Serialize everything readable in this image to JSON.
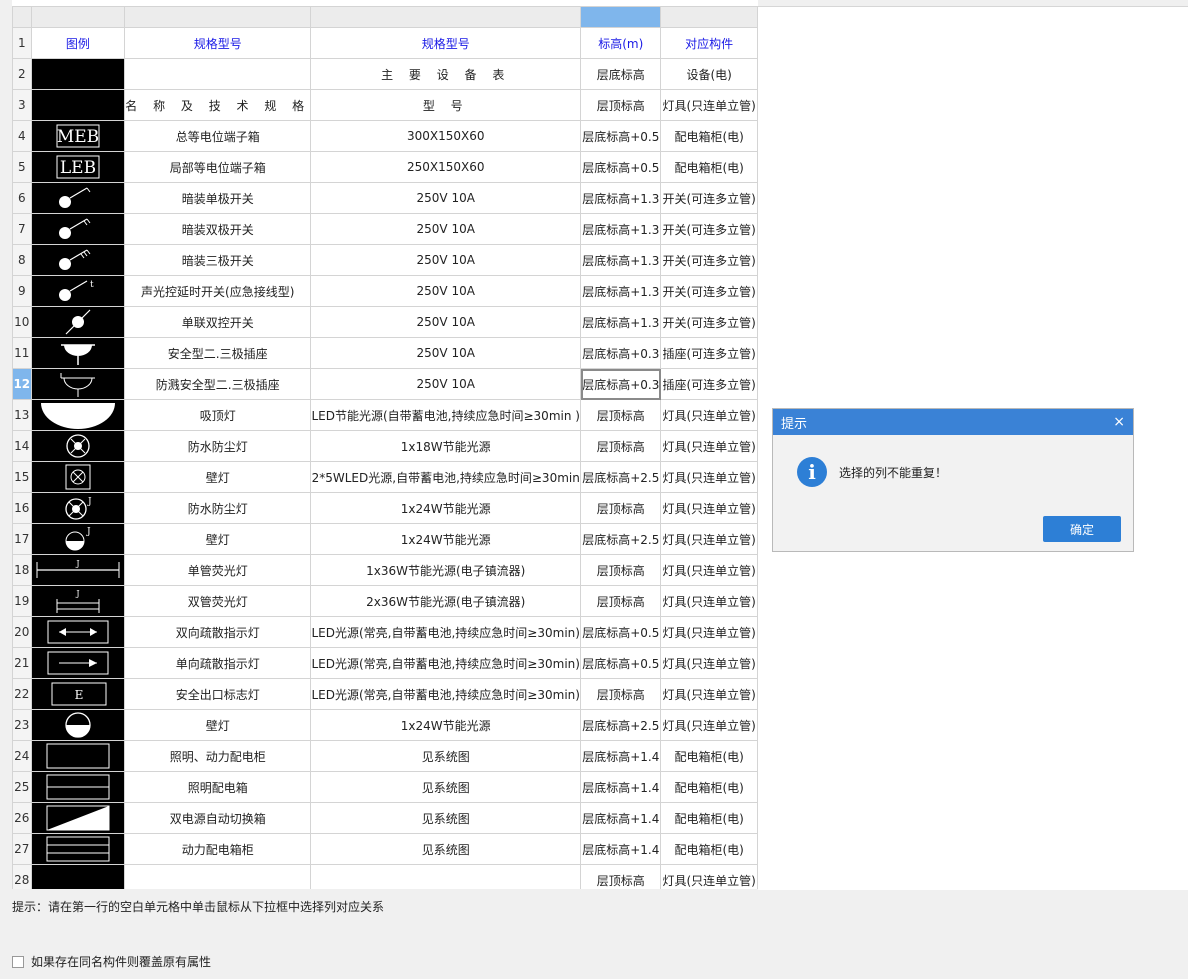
{
  "table": {
    "header": [
      "图例",
      "规格型号",
      "规格型号",
      "标高(m)",
      "对应构件"
    ],
    "rows": [
      {
        "num": "2",
        "legend": "",
        "name": "",
        "spec": "主 要 设 备 表",
        "elev": "层底标高",
        "comp": "设备(电)"
      },
      {
        "num": "3",
        "legend": "",
        "name": "名 称 及 技 术 规 格",
        "spec": "型 号",
        "elev": "层顶标高",
        "comp": "灯具(只连单立管)"
      },
      {
        "num": "4",
        "legend": "MEB",
        "name": "总等电位端子箱",
        "spec": "300X150X60",
        "elev": "层底标高+0.5",
        "comp": "配电箱柜(电)"
      },
      {
        "num": "5",
        "legend": "LEB",
        "name": "局部等电位端子箱",
        "spec": "250X150X60",
        "elev": "层底标高+0.5",
        "comp": "配电箱柜(电)"
      },
      {
        "num": "6",
        "legend": "switch-1",
        "name": "暗装单极开关",
        "spec": "250V 10A",
        "elev": "层底标高+1.3",
        "comp": "开关(可连多立管)"
      },
      {
        "num": "7",
        "legend": "switch-2",
        "name": "暗装双极开关",
        "spec": "250V 10A",
        "elev": "层底标高+1.3",
        "comp": "开关(可连多立管)"
      },
      {
        "num": "8",
        "legend": "switch-3",
        "name": "暗装三极开关",
        "spec": "250V 10A",
        "elev": "层底标高+1.3",
        "comp": "开关(可连多立管)"
      },
      {
        "num": "9",
        "legend": "switch-t",
        "name": "声光控延时开关(应急接线型)",
        "spec": "250V 10A",
        "elev": "层底标高+1.3",
        "comp": "开关(可连多立管)"
      },
      {
        "num": "10",
        "legend": "switch-dual",
        "name": "单联双控开关",
        "spec": "250V 10A",
        "elev": "层底标高+1.3",
        "comp": "开关(可连多立管)"
      },
      {
        "num": "11",
        "legend": "socket",
        "name": "安全型二.三极插座",
        "spec": "250V 10A",
        "elev": "层底标高+0.3",
        "comp": "插座(可连多立管)"
      },
      {
        "num": "12",
        "legend": "socket-splash",
        "name": "防溅安全型二.三极插座",
        "spec": "250V 10A",
        "elev": "层底标高+0.3",
        "comp": "插座(可连多立管)"
      },
      {
        "num": "13",
        "legend": "ceiling-lamp",
        "name": "吸顶灯",
        "spec": "LED节能光源(自带蓄电池,持续应急时间≥30min )",
        "elev": "层顶标高",
        "comp": "灯具(只连单立管)"
      },
      {
        "num": "14",
        "legend": "waterproof-lamp",
        "name": "防水防尘灯",
        "spec": "1x18W节能光源",
        "elev": "层顶标高",
        "comp": "灯具(只连单立管)"
      },
      {
        "num": "15",
        "legend": "wall-lamp-box",
        "name": "壁灯",
        "spec": "2*5WLED光源,自带蓄电池,持续应急时间≥30min",
        "elev": "层底标高+2.5",
        "comp": "灯具(只连单立管)"
      },
      {
        "num": "16",
        "legend": "waterproof-lamp-j",
        "name": "防水防尘灯",
        "spec": "1x24W节能光源",
        "elev": "层顶标高",
        "comp": "灯具(只连单立管)"
      },
      {
        "num": "17",
        "legend": "wall-lamp-j",
        "name": "壁灯",
        "spec": "1x24W节能光源",
        "elev": "层底标高+2.5",
        "comp": "灯具(只连单立管)"
      },
      {
        "num": "18",
        "legend": "tube-single",
        "name": "单管荧光灯",
        "spec": "1x36W节能光源(电子镇流器)",
        "elev": "层顶标高",
        "comp": "灯具(只连单立管)"
      },
      {
        "num": "19",
        "legend": "tube-double",
        "name": "双管荧光灯",
        "spec": "2x36W节能光源(电子镇流器)",
        "elev": "层顶标高",
        "comp": "灯具(只连单立管)"
      },
      {
        "num": "20",
        "legend": "exit-both",
        "name": "双向疏散指示灯",
        "spec": "LED光源(常亮,自带蓄电池,持续应急时间≥30min)",
        "elev": "层底标高+0.5",
        "comp": "灯具(只连单立管)"
      },
      {
        "num": "21",
        "legend": "exit-one",
        "name": "单向疏散指示灯",
        "spec": "LED光源(常亮,自带蓄电池,持续应急时间≥30min)",
        "elev": "层底标高+0.5",
        "comp": "灯具(只连单立管)"
      },
      {
        "num": "22",
        "legend": "E",
        "name": "安全出口标志灯",
        "spec": "LED光源(常亮,自带蓄电池,持续应急时间≥30min)",
        "elev": "层顶标高",
        "comp": "灯具(只连单立管)"
      },
      {
        "num": "23",
        "legend": "wall-lamp",
        "name": "壁灯",
        "spec": "1x24W节能光源",
        "elev": "层底标高+2.5",
        "comp": "灯具(只连单立管)"
      },
      {
        "num": "24",
        "legend": "panel-power",
        "name": "照明、动力配电柜",
        "spec": "见系统图",
        "elev": "层底标高+1.4",
        "comp": "配电箱柜(电)"
      },
      {
        "num": "25",
        "legend": "panel-light",
        "name": "照明配电箱",
        "spec": "见系统图",
        "elev": "层底标高+1.4",
        "comp": "配电箱柜(电)"
      },
      {
        "num": "26",
        "legend": "panel-ats",
        "name": "双电源自动切换箱",
        "spec": "见系统图",
        "elev": "层底标高+1.4",
        "comp": "配电箱柜(电)"
      },
      {
        "num": "27",
        "legend": "panel-motor",
        "name": "动力配电箱柜",
        "spec": "见系统图",
        "elev": "层底标高+1.4",
        "comp": "配电箱柜(电)"
      },
      {
        "num": "28",
        "legend": "",
        "name": "",
        "spec": "",
        "elev": "层顶标高",
        "comp": "灯具(只连单立管)"
      }
    ]
  },
  "selected_row": "12",
  "hint": "提示：请在第一行的空白单元格中单击鼠标从下拉框中选择列对应关系",
  "overwrite_label": "如果存在同名构件则覆盖原有属性",
  "dialog": {
    "title": "提示",
    "message": "选择的列不能重复！",
    "ok_label": "确定",
    "close_glyph": "×"
  }
}
